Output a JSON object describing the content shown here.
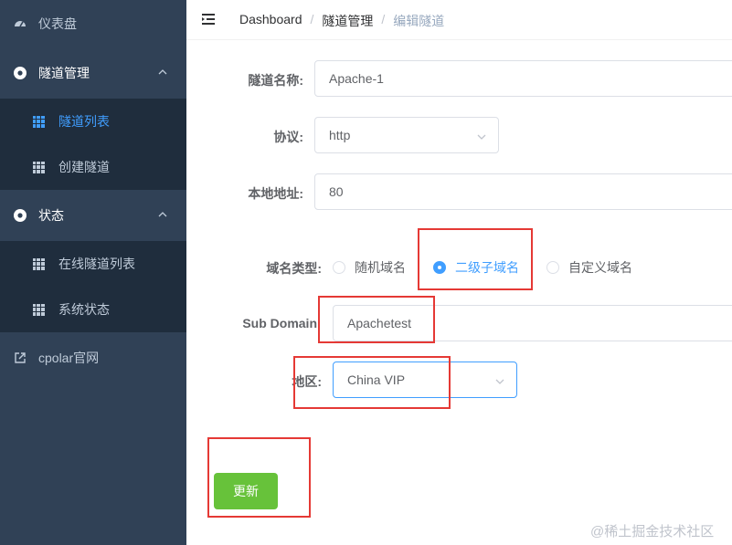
{
  "sidebar": {
    "items": [
      {
        "label": "仪表盘",
        "icon": "dashboard-icon"
      },
      {
        "label": "隧道管理",
        "icon": "tunnel-management-icon"
      },
      {
        "label": "隧道列表",
        "icon": "grid-icon",
        "active": true
      },
      {
        "label": "创建隧道",
        "icon": "grid-icon"
      },
      {
        "label": "状态",
        "icon": "status-icon"
      },
      {
        "label": "在线隧道列表",
        "icon": "grid-icon"
      },
      {
        "label": "系统状态",
        "icon": "grid-icon"
      },
      {
        "label": "cpolar官网",
        "icon": "external-link-icon"
      }
    ]
  },
  "breadcrumb": [
    "Dashboard",
    "隧道管理",
    "编辑隧道"
  ],
  "form": {
    "name_label": "隧道名称:",
    "name_value": "Apache-1",
    "protocol_label": "协议:",
    "protocol_value": "http",
    "local_label": "本地地址:",
    "local_value": "80",
    "domain_type_label": "域名类型:",
    "domain_options": [
      "随机域名",
      "二级子域名",
      "自定义域名"
    ],
    "domain_selected": "二级子域名",
    "subdomain_label": "Sub Domain",
    "subdomain_value": "Apachetest",
    "region_label": "地区:",
    "region_value": "China VIP",
    "submit_label": "更新"
  },
  "colors": {
    "sidebar_bg": "#304156",
    "submenu_bg": "#1f2d3d",
    "primary": "#409eff",
    "success": "#67c23a",
    "highlight_box": "#e53935"
  },
  "watermark": "@稀土掘金技术社区"
}
